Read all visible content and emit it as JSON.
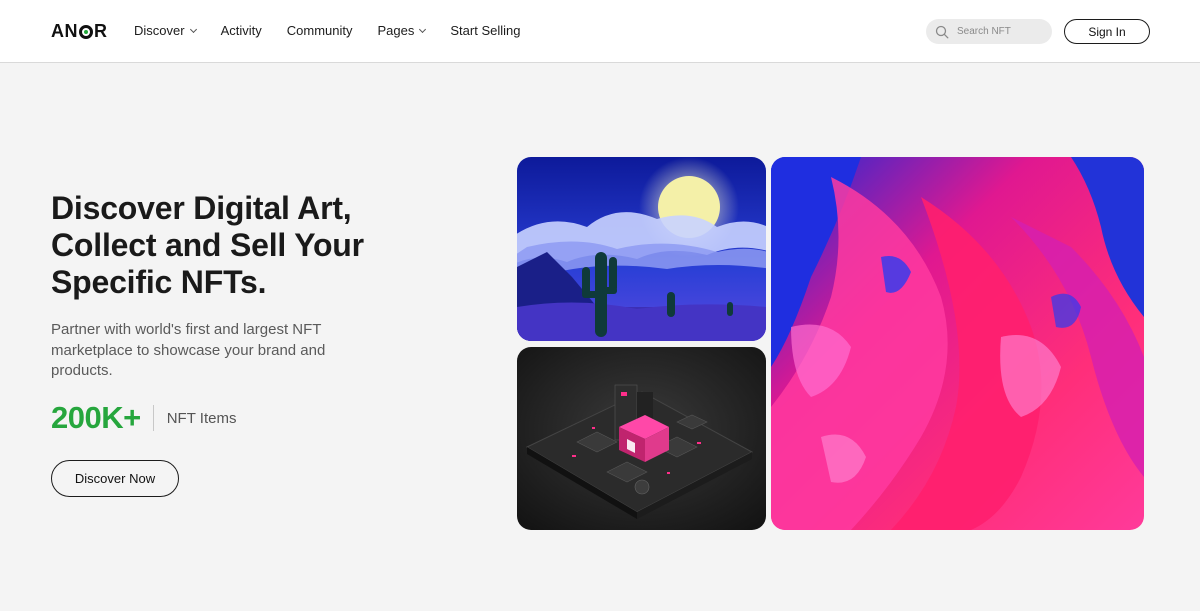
{
  "header": {
    "logo": {
      "prefix": "AN",
      "suffix": "R"
    },
    "nav": [
      {
        "label": "Discover",
        "has_dropdown": true
      },
      {
        "label": "Activity",
        "has_dropdown": false
      },
      {
        "label": "Community",
        "has_dropdown": false
      },
      {
        "label": "Pages",
        "has_dropdown": true
      },
      {
        "label": "Start Selling",
        "has_dropdown": false
      }
    ],
    "search": {
      "placeholder": "Search NFT",
      "icon": "search-icon"
    },
    "signin_label": "Sign In"
  },
  "hero": {
    "title": "Discover Digital Art, Collect and Sell Your Specific NFTs.",
    "subtitle": "Partner with world's first and largest NFT marketplace to showcase your brand and products.",
    "stat": {
      "value": "200K+",
      "label": "NFT Items"
    },
    "cta_label": "Discover Now"
  },
  "gallery": [
    {
      "name": "desert-moon-art"
    },
    {
      "name": "isometric-city-art"
    },
    {
      "name": "fluid-paint-art"
    }
  ],
  "colors": {
    "accent_green": "#26a63d",
    "text_dark": "#1a1a1a",
    "background": "#f4f4f4"
  }
}
